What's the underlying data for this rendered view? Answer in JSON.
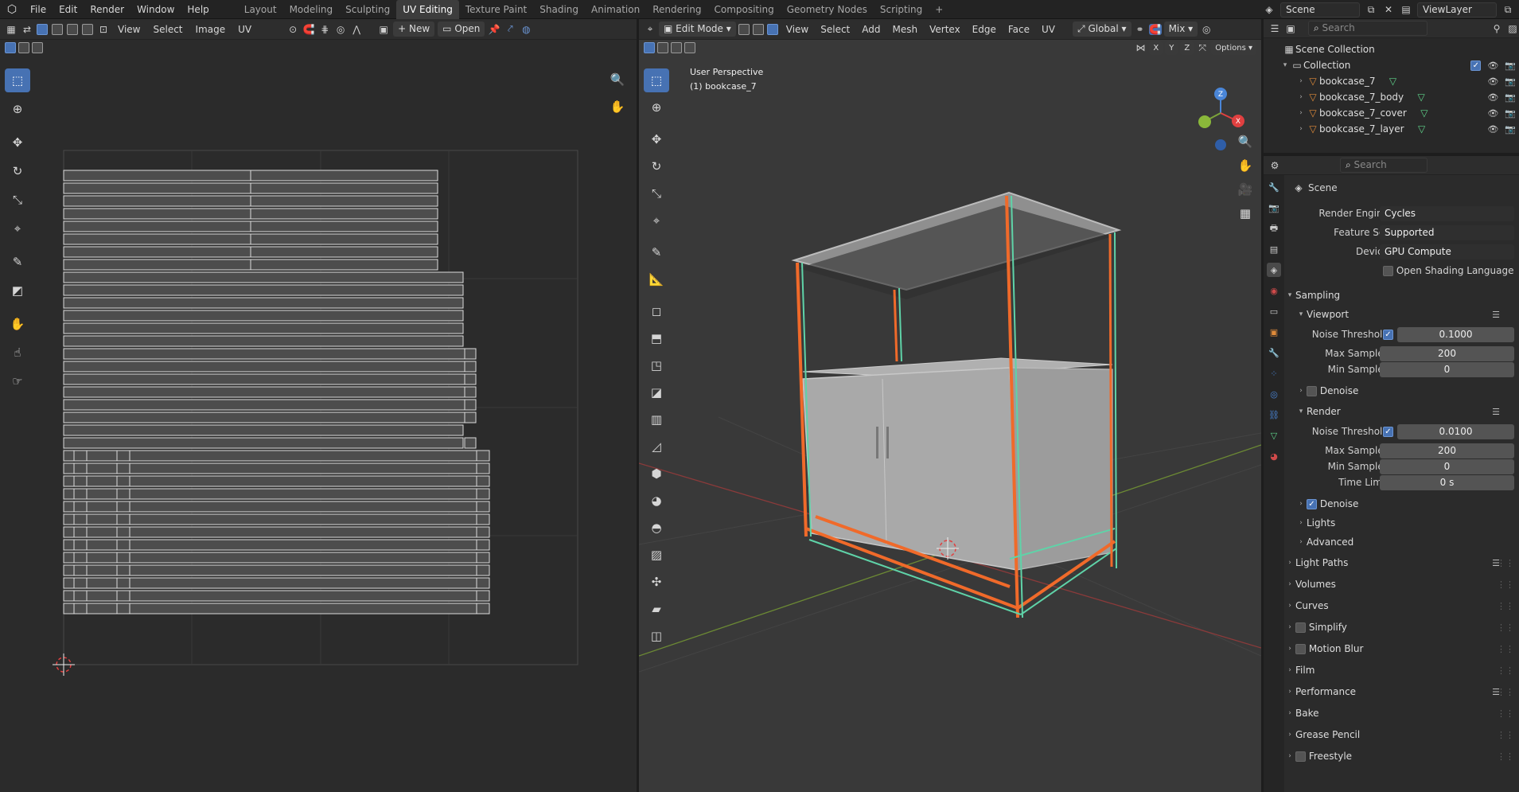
{
  "menu": [
    "File",
    "Edit",
    "Render",
    "Window",
    "Help"
  ],
  "workspaces": [
    "Layout",
    "Modeling",
    "Sculpting",
    "UV Editing",
    "Texture Paint",
    "Shading",
    "Animation",
    "Rendering",
    "Compositing",
    "Geometry Nodes",
    "Scripting"
  ],
  "active_workspace": "UV Editing",
  "scene_name": "Scene",
  "view_layer": "ViewLayer",
  "uv_editor": {
    "menus": [
      "View",
      "Select",
      "Image",
      "UV"
    ],
    "new_label": "New",
    "open_label": "Open"
  },
  "viewport": {
    "mode": "Edit Mode",
    "menus": [
      "View",
      "Select",
      "Add",
      "Mesh",
      "Vertex",
      "Edge",
      "Face",
      "UV"
    ],
    "orientation": "Global",
    "shading": "Mix",
    "options_label": "Options",
    "axes": [
      "X",
      "Y",
      "Z"
    ],
    "overlay_line1": "User Perspective",
    "overlay_line2": "(1) bookcase_7",
    "gizmo_z": "Z",
    "gizmo_x": "X"
  },
  "outliner": {
    "search_placeholder": "Search",
    "root": "Scene Collection",
    "collection": "Collection",
    "items": [
      "bookcase_7",
      "bookcase_7_body",
      "bookcase_7_cover",
      "bookcase_7_layer"
    ]
  },
  "properties": {
    "search_placeholder": "Search",
    "context": "Scene",
    "render_engine_label": "Render Engine",
    "render_engine": "Cycles",
    "feature_set_label": "Feature Set",
    "feature_set": "Supported",
    "device_label": "Device",
    "device": "GPU Compute",
    "osl_label": "Open Shading Language",
    "sampling": "Sampling",
    "viewport": "Viewport",
    "render": "Render",
    "noise_threshold_label": "Noise Threshold",
    "viewport_noise": "0.1000",
    "render_noise": "0.0100",
    "max_samples_label": "Max Samples",
    "min_samples_label": "Min Samples",
    "viewport_max": "200",
    "viewport_min": "0",
    "render_max": "200",
    "render_min": "0",
    "time_limit_label": "Time Limit",
    "time_limit": "0 s",
    "denoise_label": "Denoise",
    "lights": "Lights",
    "advanced": "Advanced",
    "sections": [
      "Light Paths",
      "Volumes",
      "Curves",
      "Simplify",
      "Motion Blur",
      "Film",
      "Performance",
      "Bake",
      "Grease Pencil",
      "Freestyle"
    ]
  },
  "colors": {
    "accent": "#4772b3",
    "selected_edge": "#f06a2a",
    "edge_highlight": "#5fd3a8"
  }
}
